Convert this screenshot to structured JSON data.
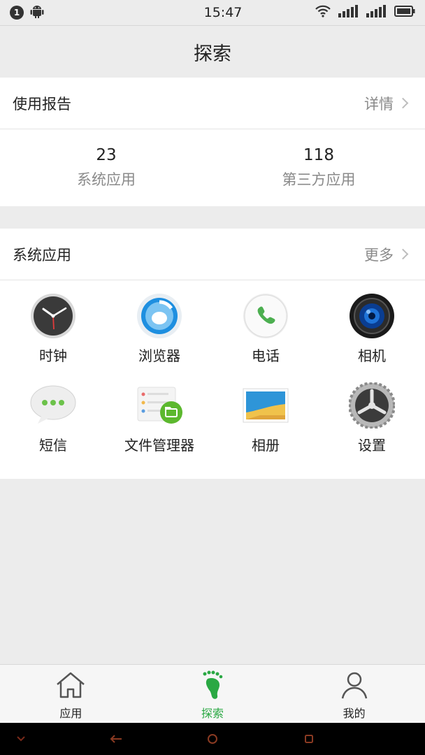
{
  "status_bar": {
    "notification_count": "1",
    "time": "15:47",
    "icons": [
      "android-icon",
      "wifi-icon",
      "signal-icon",
      "signal-icon",
      "battery-icon"
    ]
  },
  "header": {
    "title": "探索"
  },
  "usage_report": {
    "title": "使用报告",
    "link_label": "详情",
    "stats": [
      {
        "value": "23",
        "label": "系统应用"
      },
      {
        "value": "118",
        "label": "第三方应用"
      }
    ]
  },
  "system_apps": {
    "title": "系统应用",
    "link_label": "更多",
    "apps": [
      {
        "label": "时钟",
        "icon": "clock-icon"
      },
      {
        "label": "浏览器",
        "icon": "browser-icon"
      },
      {
        "label": "电话",
        "icon": "phone-icon"
      },
      {
        "label": "相机",
        "icon": "camera-icon"
      },
      {
        "label": "短信",
        "icon": "messages-icon"
      },
      {
        "label": "文件管理器",
        "icon": "file-manager-icon"
      },
      {
        "label": "相册",
        "icon": "gallery-icon"
      },
      {
        "label": "设置",
        "icon": "settings-icon"
      }
    ]
  },
  "tab_bar": {
    "tabs": [
      {
        "label": "应用",
        "icon": "home-icon",
        "active": false
      },
      {
        "label": "探索",
        "icon": "footprint-icon",
        "active": true
      },
      {
        "label": "我的",
        "icon": "person-icon",
        "active": false
      }
    ]
  },
  "colors": {
    "accent": "#2aa843",
    "background": "#ececec",
    "muted_text": "#8a8a8a"
  }
}
